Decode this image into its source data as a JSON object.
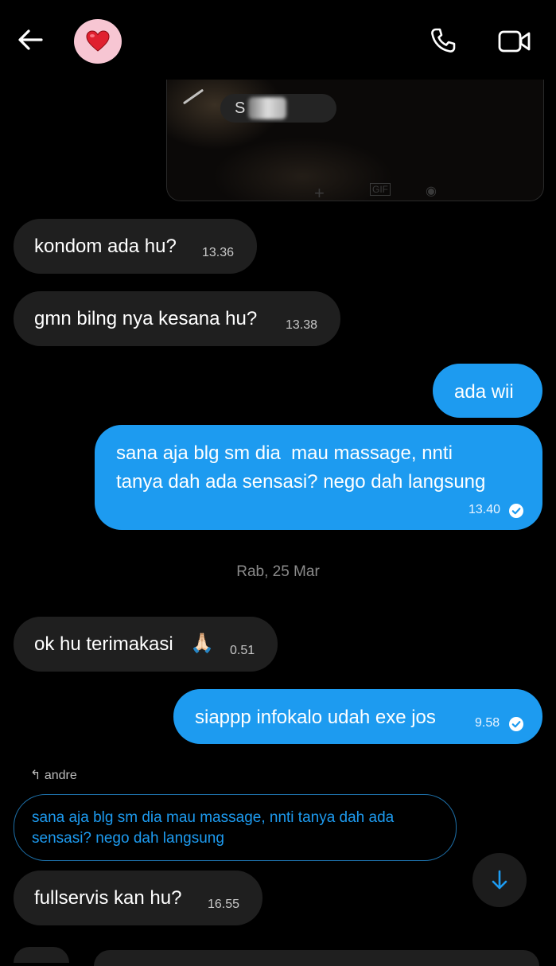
{
  "header": {
    "back_icon": "arrow-left-icon",
    "avatar_icon": "red-heart-icon",
    "call_icon": "phone-icon",
    "video_icon": "video-camera-icon"
  },
  "media": {
    "pill_text": "S"
  },
  "messages": [
    {
      "direction": "in",
      "text": "kondom ada hu?",
      "time": "13.36"
    },
    {
      "direction": "in",
      "text": "gmn bilng nya kesana hu?",
      "time": "13.38"
    },
    {
      "direction": "out",
      "text": "ada wii"
    },
    {
      "direction": "out",
      "text_line1": "sana aja blg sm dia  mau massage, nnti",
      "text_line2": "tanya dah ada sensasi? nego dah langsung",
      "time": "13.40"
    },
    {
      "direction": "in",
      "text": "ok hu terimakasi",
      "emoji": "🙏🏻",
      "time": "0.51"
    },
    {
      "direction": "out",
      "text": "siappp infokalo udah exe jos",
      "time": "9.58"
    },
    {
      "direction": "in",
      "text": "fullservis kan hu?",
      "time": "16.55"
    }
  ],
  "date_separator": "Rab, 25 Mar",
  "reply": {
    "author": "andre",
    "quoted_text": "sana aja blg sm dia  mau massage, nnti tanya dah ada sensasi? nego dah langsung"
  },
  "colors": {
    "background": "#000000",
    "incoming_bubble": "#1f1f1f",
    "outgoing_bubble": "#1d9bf0"
  }
}
